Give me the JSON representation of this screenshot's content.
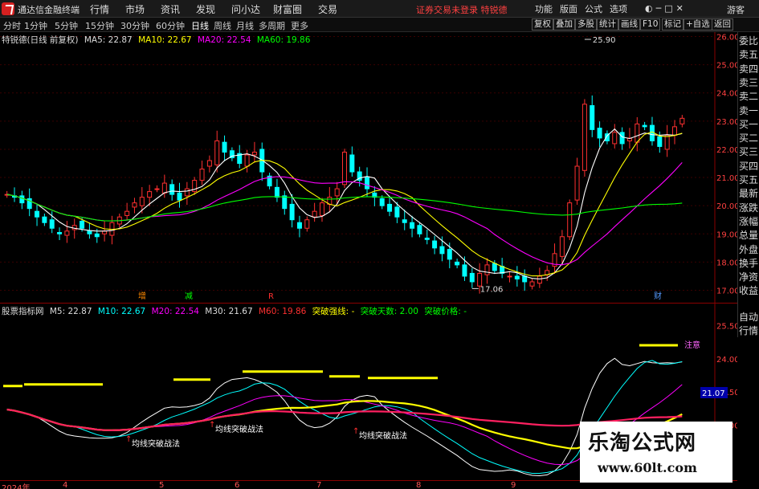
{
  "menubar": {
    "app_title": "通达信金融终端",
    "menus": [
      "行情",
      "市场",
      "资讯",
      "发现",
      "问小达",
      "财富圈",
      "交易"
    ],
    "notice": "证券交易未登录  特锐德",
    "right_menus": [
      "功能",
      "版面",
      "公式",
      "选项"
    ],
    "guest": "游客"
  },
  "toolbar": {
    "tabs": [
      "分时",
      "1分钟",
      "5分钟",
      "15分钟",
      "30分钟",
      "60分钟",
      "日线",
      "周线",
      "月线",
      "多周期",
      "更多"
    ],
    "active_tab": "日线",
    "buttons": [
      "复权",
      "叠加",
      "多股",
      "统计",
      "画线",
      "F10",
      "标记",
      "+自选",
      "返回"
    ]
  },
  "main_legend": {
    "stock": "特锐德(日线 前复权)",
    "ma5": "MA5: 22.87",
    "ma10": "MA10: 22.67",
    "ma20": "MA20: 22.54",
    "ma60": "MA60: 19.86"
  },
  "sub_legend": {
    "name": "股票指标网",
    "m5": "M5: 22.87",
    "m10": "M10: 22.67",
    "m20": "M20: 22.54",
    "m30": "M30: 21.67",
    "m60": "M60: 19.86",
    "line_label": "突破强线: -",
    "days": "突破天数: 2.00",
    "price": "突破价格: -"
  },
  "side_panel": [
    "委比",
    "卖五",
    "卖四",
    "卖三",
    "卖二",
    "卖一",
    "买一",
    "买二",
    "买三",
    "买四",
    "买五",
    "最新",
    "涨跌",
    "涨幅",
    "总量",
    "外盘",
    "换手",
    "净资",
    "收益",
    "自动",
    "行情"
  ],
  "annotations": {
    "high": "25.90",
    "low": "17.06",
    "tag_cai": "财",
    "tag_jian": "减",
    "tag_zeng": "增",
    "tag_r": "R",
    "signal_text": "均线突破战法",
    "attention": "注意",
    "current_price": "21.07"
  },
  "x_axis": [
    "2024年",
    "4",
    "5",
    "6",
    "7",
    "8",
    "9"
  ],
  "colors": {
    "up": "#ff3030",
    "down": "#00ffff",
    "ma5": "#ffffff",
    "ma10": "#ffff00",
    "ma20": "#ff00ff",
    "ma60": "#00ff00",
    "accent": "#ff3030"
  },
  "chart_data": {
    "type": "candlestick",
    "yaxis_main": [
      "26.00",
      "25.00",
      "24.00",
      "23.00",
      "22.00",
      "21.00",
      "20.00",
      "19.00",
      "18.00",
      "17.00"
    ],
    "ylim_main": [
      16.9,
      26.1
    ],
    "yaxis_sub": [
      "25.50",
      "24.00",
      "22.50",
      "21.00"
    ],
    "closes": [
      20.4,
      20.3,
      20.1,
      19.9,
      19.6,
      19.4,
      19.2,
      19.0,
      19.1,
      19.3,
      19.2,
      19.0,
      18.9,
      19.1,
      19.4,
      19.6,
      19.8,
      20.1,
      20.3,
      20.5,
      20.6,
      20.8,
      20.4,
      20.2,
      20.6,
      20.9,
      21.3,
      21.6,
      22.3,
      21.9,
      21.7,
      21.5,
      21.8,
      21.9,
      21.2,
      20.7,
      20.3,
      19.9,
      19.5,
      19.2,
      19.5,
      19.8,
      20.1,
      20.3,
      20.6,
      21.9,
      21.2,
      20.9,
      20.6,
      20.3,
      20.0,
      19.8,
      19.6,
      19.4,
      19.2,
      19.0,
      18.8,
      18.5,
      18.3,
      18.1,
      17.9,
      17.5,
      17.3,
      17.6,
      17.9,
      17.7,
      17.6,
      17.5,
      17.4,
      17.3,
      17.3,
      17.5,
      17.7,
      18.3,
      18.9,
      20.1,
      21.4,
      23.6,
      22.7,
      22.4,
      22.3,
      22.6,
      22.2,
      22.4,
      22.9,
      22.8,
      22.3,
      22.1,
      22.5,
      22.8,
      23.1
    ]
  }
}
